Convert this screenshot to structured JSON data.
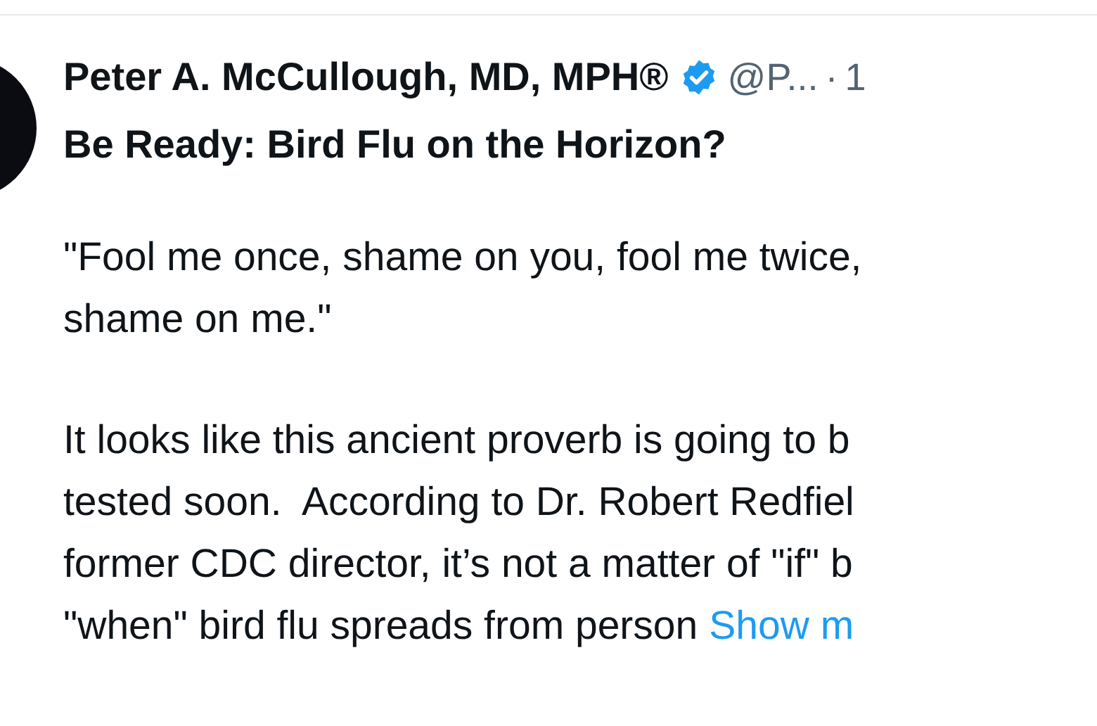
{
  "post": {
    "author_name": "Peter A. McCullough, MD, MPH®",
    "verified": true,
    "handle": "@P...",
    "separator": "·",
    "time": "1",
    "title": "Be Ready: Bird Flu on the Horizon?",
    "paragraphs": [
      {
        "lines": [
          {
            "text": "\"Fool me once, shame on you, fool me twice,"
          },
          {
            "text": "shame on me.\""
          }
        ]
      },
      {
        "lines": [
          {
            "text": "It looks like this ancient proverb is going to b"
          },
          {
            "text": "tested soon.  According to Dr. Robert Redfiel"
          },
          {
            "text": "former CDC director, it’s not a matter of \"if\" b"
          },
          {
            "text": "\"when\" bird flu spreads from person",
            "link": "Show m"
          }
        ]
      }
    ]
  }
}
